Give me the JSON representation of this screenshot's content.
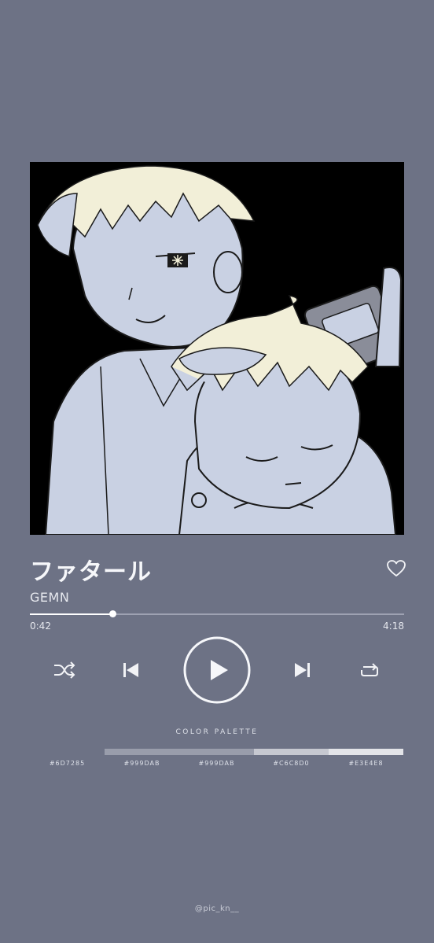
{
  "track": {
    "title": "ファタール",
    "artist": "GEMN"
  },
  "playback": {
    "current_time": "0:42",
    "total_time": "4:18",
    "progress_fraction": 0.22
  },
  "controls": {
    "shuffle_icon": "shuffle-icon",
    "previous_icon": "previous-icon",
    "play_icon": "play-icon",
    "next_icon": "next-icon",
    "repeat_icon": "repeat-icon",
    "like_icon": "heart-icon"
  },
  "palette": {
    "title": "COLOR PALETTE",
    "swatches": [
      {
        "label": "#6D7285",
        "color": "#6D7285"
      },
      {
        "label": "#999DAB",
        "color": "#999DAB"
      },
      {
        "label": "#999DAB",
        "color": "#999DAB"
      },
      {
        "label": "#C6C8D0",
        "color": "#C6C8D0"
      },
      {
        "label": "#E3E4E8",
        "color": "#E3E4E8"
      }
    ]
  },
  "credit": "@pic_kn__",
  "colors": {
    "background": "#6D7285",
    "artwork_bg": "#000000",
    "skin": "#C9D1E3",
    "hair": "#F2EFD8"
  }
}
